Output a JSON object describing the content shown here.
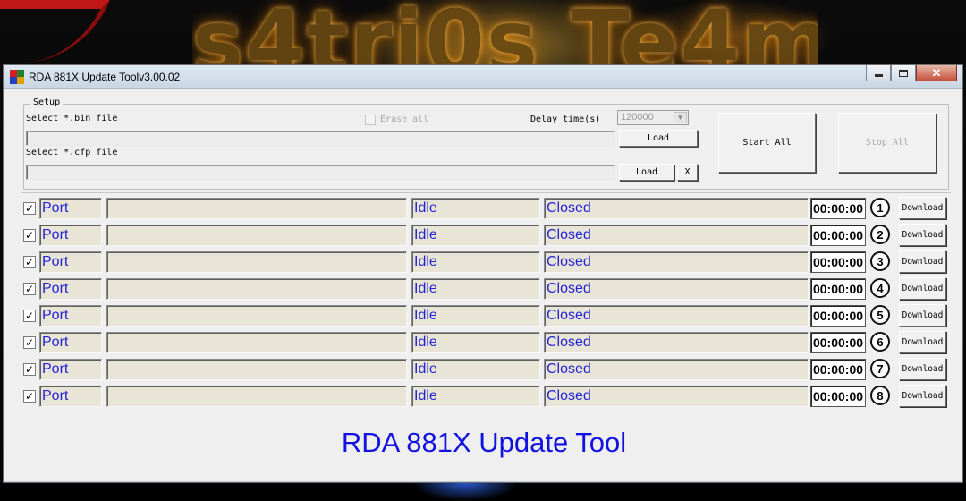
{
  "window": {
    "title": "RDA 881X Update Toolv3.00.02",
    "close_glyph": "✕"
  },
  "setup": {
    "legend": "Setup",
    "bin_label": "Select *.bin file",
    "bin_value": "",
    "cfp_label": "Select *.cfp file",
    "cfp_value": "",
    "erase_all_label": "Erase all",
    "erase_all_checked": false,
    "delay_label": "Delay time(s)",
    "delay_value": "120000",
    "load_bin_label": "Load",
    "load_cfp_label": "Load",
    "clear_label": "X",
    "start_all_label": "Start All",
    "stop_all_label": "Stop All"
  },
  "rows": [
    {
      "checked": "✓",
      "port": "Port",
      "progress": "",
      "state": "Idle",
      "status": "Closed",
      "time": "00:00:00",
      "index": "1",
      "button": "Download"
    },
    {
      "checked": "✓",
      "port": "Port",
      "progress": "",
      "state": "Idle",
      "status": "Closed",
      "time": "00:00:00",
      "index": "2",
      "button": "Download"
    },
    {
      "checked": "✓",
      "port": "Port",
      "progress": "",
      "state": "Idle",
      "status": "Closed",
      "time": "00:00:00",
      "index": "3",
      "button": "Download"
    },
    {
      "checked": "✓",
      "port": "Port",
      "progress": "",
      "state": "Idle",
      "status": "Closed",
      "time": "00:00:00",
      "index": "4",
      "button": "Download"
    },
    {
      "checked": "✓",
      "port": "Port",
      "progress": "",
      "state": "Idle",
      "status": "Closed",
      "time": "00:00:00",
      "index": "5",
      "button": "Download"
    },
    {
      "checked": "✓",
      "port": "Port",
      "progress": "",
      "state": "Idle",
      "status": "Closed",
      "time": "00:00:00",
      "index": "6",
      "button": "Download"
    },
    {
      "checked": "✓",
      "port": "Port",
      "progress": "",
      "state": "Idle",
      "status": "Closed",
      "time": "00:00:00",
      "index": "7",
      "button": "Download"
    },
    {
      "checked": "✓",
      "port": "Port",
      "progress": "",
      "state": "Idle",
      "status": "Closed",
      "time": "00:00:00",
      "index": "8",
      "button": "Download"
    }
  ],
  "footer": {
    "title": "RDA 881X Update Tool"
  },
  "colors": {
    "row_text": "#2323d6",
    "footer_text": "#1212e0"
  }
}
